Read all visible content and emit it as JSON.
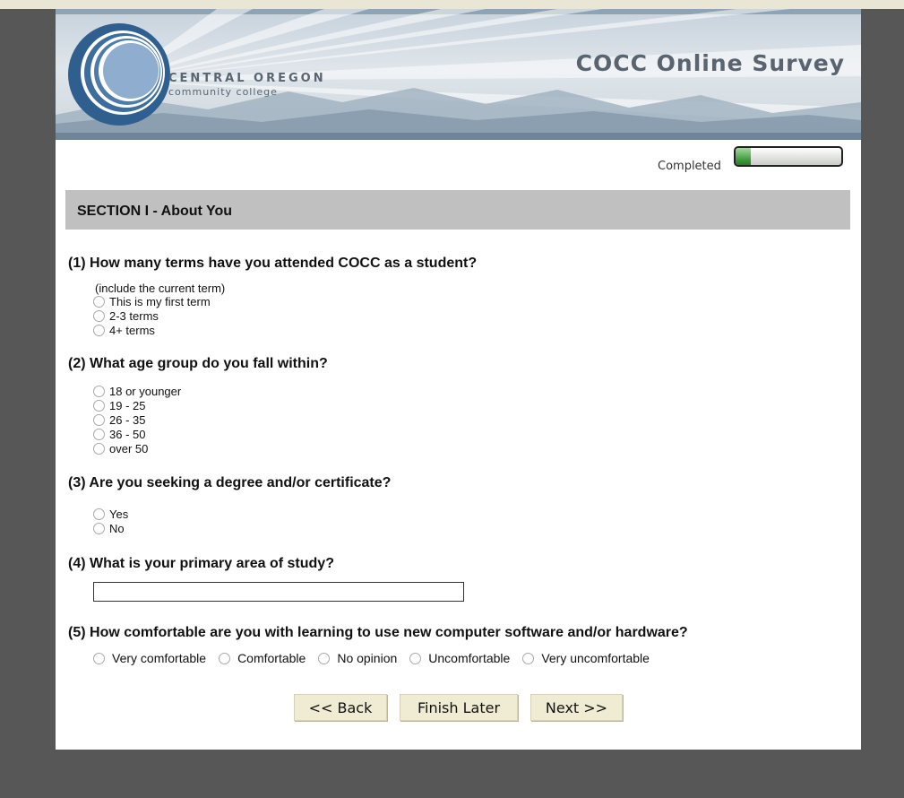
{
  "header": {
    "college_name_line1": "CENTRAL OREGON",
    "college_name_line2": "community college",
    "title": "COCC Online Survey"
  },
  "progress": {
    "label": "Completed",
    "fraction": 0.14
  },
  "section": {
    "title": "SECTION I - About You"
  },
  "questions": [
    {
      "number": "(1)",
      "text": "How many terms have you attended COCC as a student?",
      "note": "(include the current term)",
      "options": [
        "This is my first term",
        "2-3 terms",
        "4+ terms"
      ]
    },
    {
      "number": "(2)",
      "text": "What age group do you fall within?",
      "options": [
        "18 or younger",
        "19 - 25",
        "26 - 35",
        "36 - 50",
        "over 50"
      ]
    },
    {
      "number": "(3)",
      "text": "Are you seeking a degree and/or certificate?",
      "options": [
        "Yes",
        "No"
      ]
    },
    {
      "number": "(4)",
      "text": "What is your primary area of study?",
      "input_value": ""
    },
    {
      "number": "(5)",
      "text": "How comfortable are you with learning to use new computer software and/or hardware?",
      "options": [
        "Very comfortable",
        "Comfortable",
        "No opinion",
        "Uncomfortable",
        "Very uncomfortable"
      ]
    }
  ],
  "buttons": {
    "back": "<< Back",
    "finish_later": "Finish Later",
    "next": "Next >>"
  },
  "colors": {
    "page_background": "#575757",
    "section_header": "#c0c0c0",
    "button_bg": "#f0ecd4",
    "progress_fill": "#3f9a3d"
  }
}
